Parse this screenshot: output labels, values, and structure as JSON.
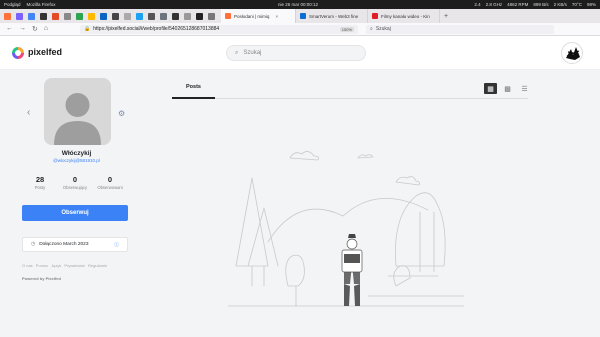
{
  "system": {
    "left": [
      "Podgląd",
      "Mozilla Firefox"
    ],
    "clock": "nie 26 mar  00:00:12",
    "right": [
      "2.4",
      "2.8 GHz",
      "4862 RPM",
      "899 B/s",
      "2 KB/s",
      "70°C",
      "98%"
    ]
  },
  "browser": {
    "tabs": [
      {
        "label": "Posłodani | mimiq",
        "color": "#ff7139",
        "active": true
      },
      {
        "label": "SmartVerum - Web3 fine",
        "color": "#0b6cd3",
        "active": false
      },
      {
        "label": "Filmy kanału wideo - Kin",
        "color": "#e31b23",
        "active": false
      }
    ],
    "url": "https://pixelfed.social/i/web/profile/5402651286870138​84",
    "zoom": "150%",
    "search_placeholder": "Szukaj"
  },
  "site": {
    "brand": "pixelfed",
    "search_placeholder": "Szukaj"
  },
  "profile": {
    "name": "Włóczykij",
    "handle": "@wloczykij@581910.pl",
    "stats": [
      {
        "value": "28",
        "label": "Posty"
      },
      {
        "value": "0",
        "label": "Obserwujący"
      },
      {
        "value": "0",
        "label": "Obserwowani"
      }
    ],
    "follow_label": "Obserwuj",
    "joined_label": "Dołączono March 2023",
    "footer_links": [
      "O nas",
      "Pomoc",
      "Język",
      "Prywatność",
      "Regulamin"
    ],
    "powered": "Powered by Pixelfed"
  },
  "content": {
    "tab_posts": "Posts"
  },
  "colors": {
    "accent": "#3b82f6",
    "page_bg": "#f3f4f6"
  }
}
